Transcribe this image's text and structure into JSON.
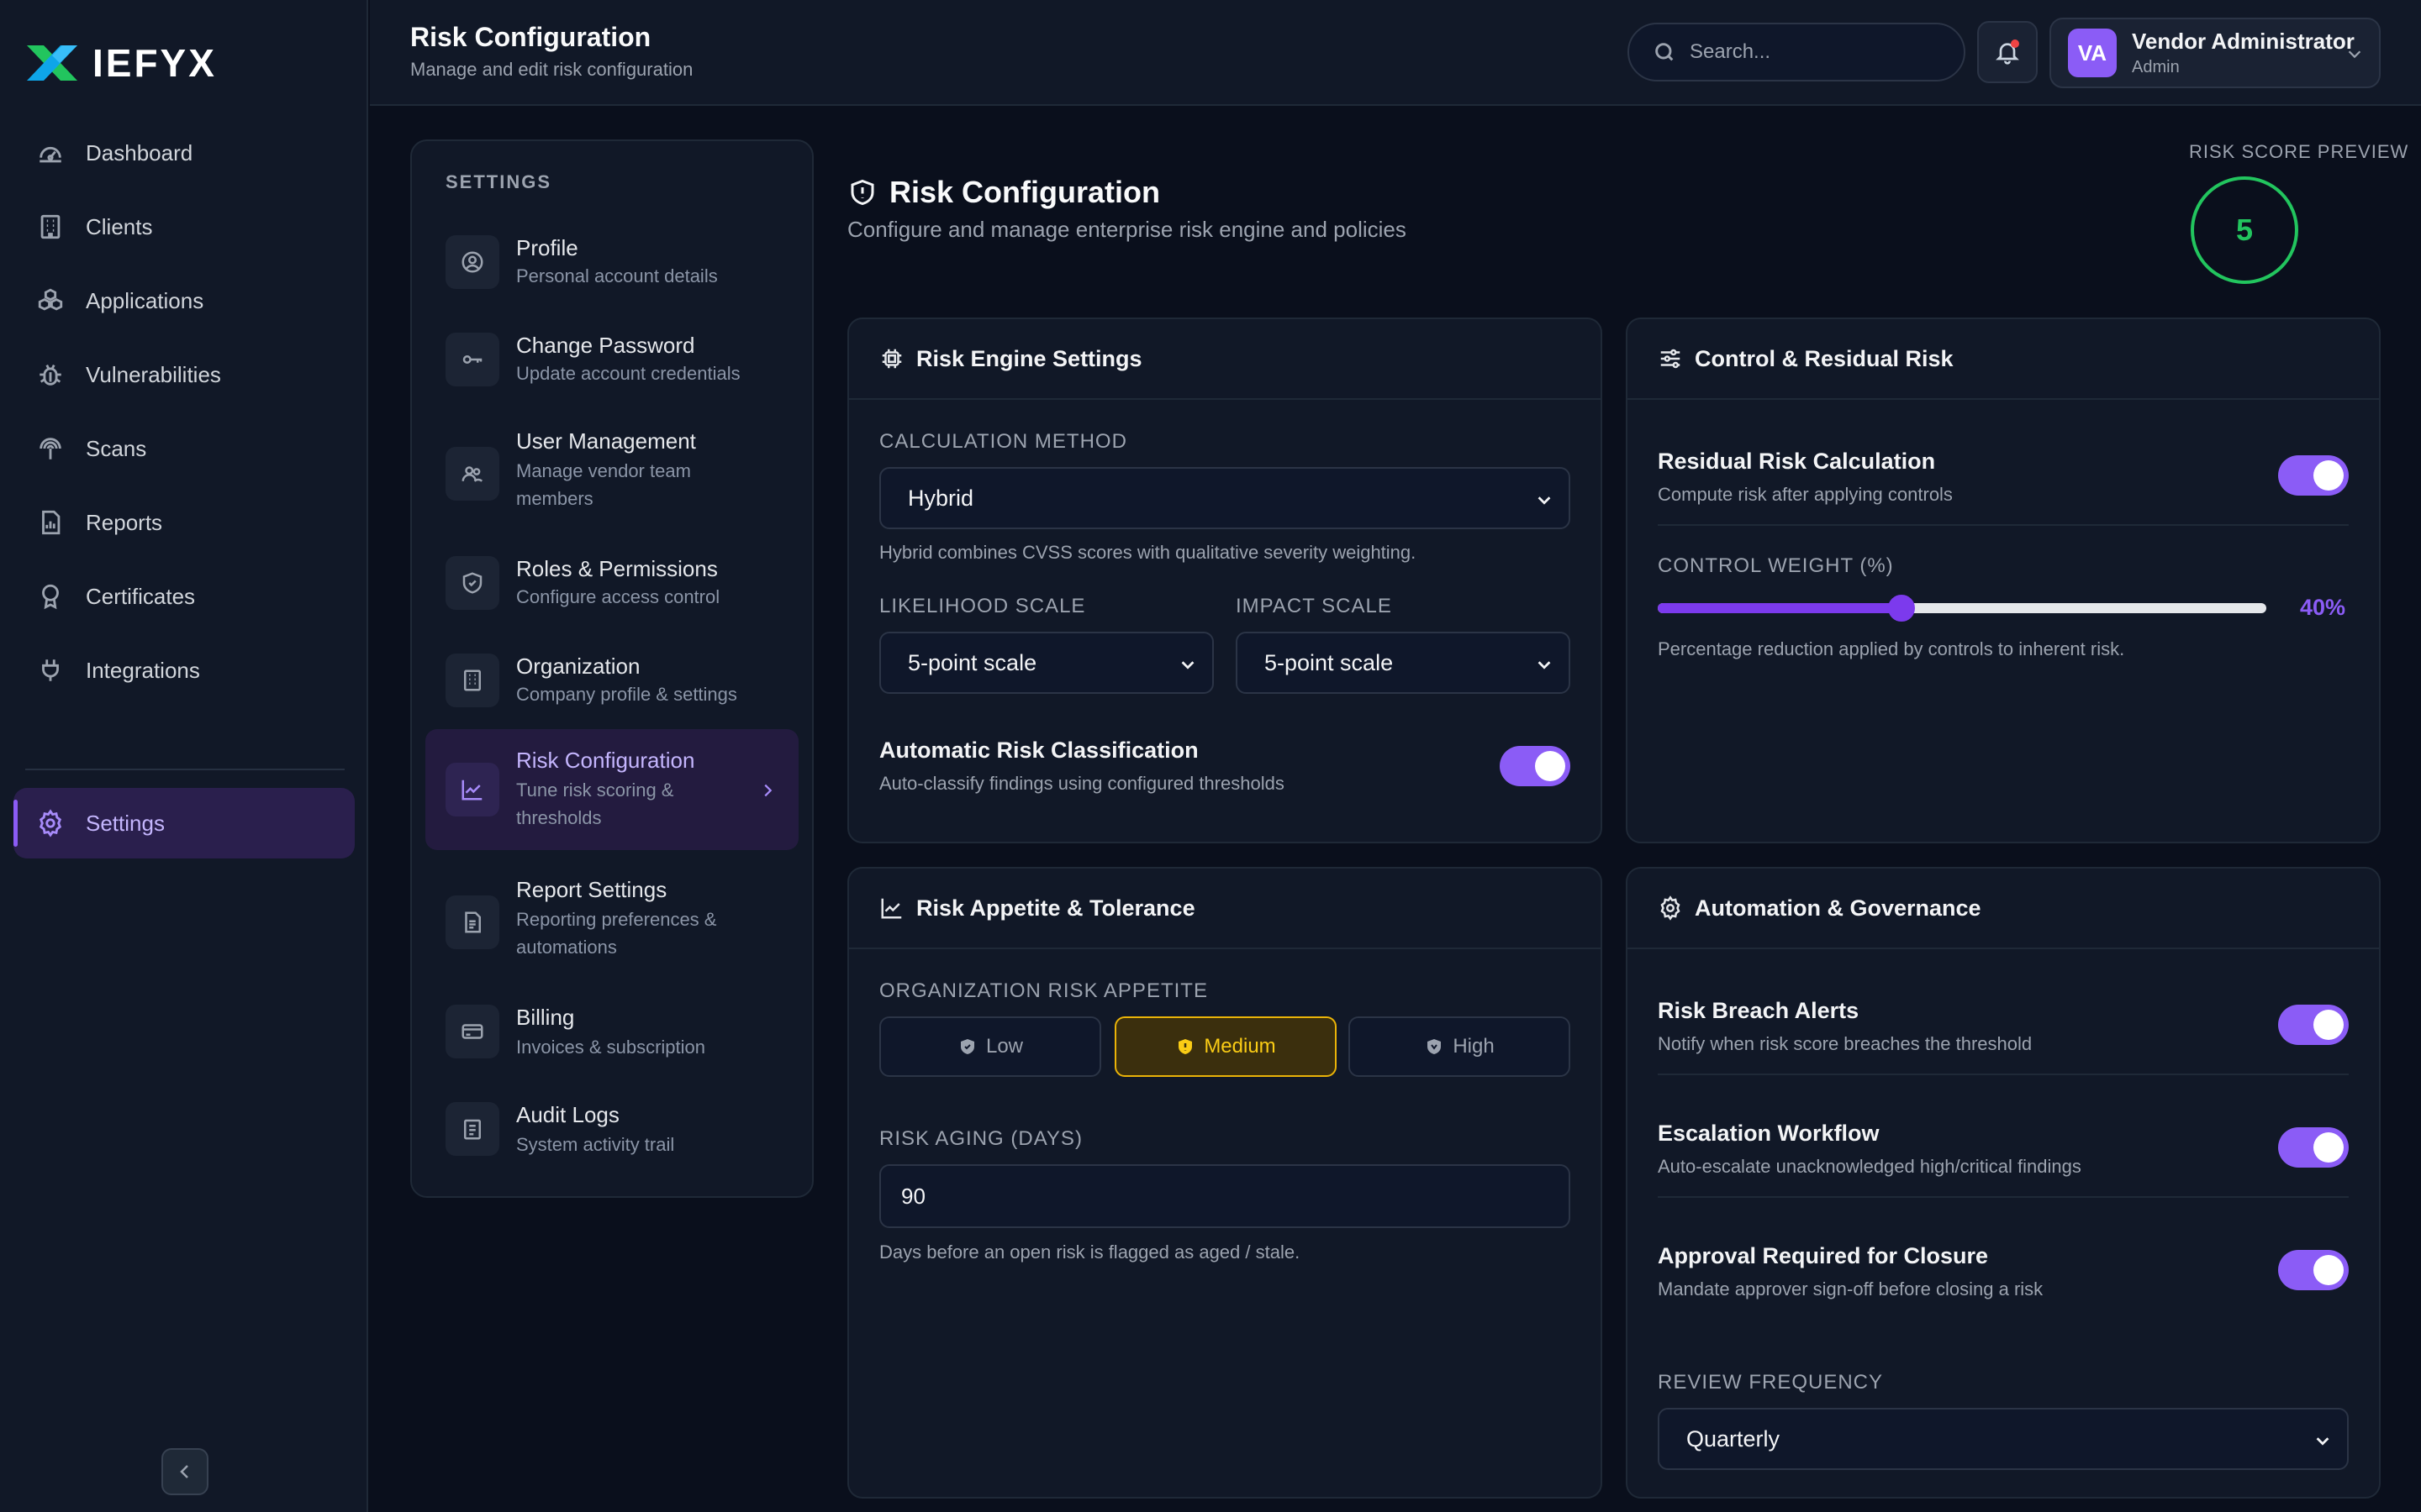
{
  "brand": {
    "name": "IEFYX"
  },
  "sidebar": {
    "items": [
      {
        "label": "Dashboard",
        "icon": "gauge-icon"
      },
      {
        "label": "Clients",
        "icon": "building-icon"
      },
      {
        "label": "Applications",
        "icon": "cubes-icon"
      },
      {
        "label": "Vulnerabilities",
        "icon": "bug-icon"
      },
      {
        "label": "Scans",
        "icon": "radar-icon"
      },
      {
        "label": "Reports",
        "icon": "report-icon"
      },
      {
        "label": "Certificates",
        "icon": "award-icon"
      },
      {
        "label": "Integrations",
        "icon": "plug-icon"
      }
    ],
    "active": {
      "label": "Settings",
      "icon": "gear-icon"
    }
  },
  "header": {
    "title": "Risk Configuration",
    "subtitle": "Manage and edit risk configuration",
    "search_placeholder": "Search...",
    "user": {
      "initials": "VA",
      "name": "Vendor Administrator",
      "role": "Admin"
    }
  },
  "settings_menu": {
    "heading": "SETTINGS",
    "items": [
      {
        "title": "Profile",
        "desc": "Personal account details"
      },
      {
        "title": "Change Password",
        "desc": "Update account credentials"
      },
      {
        "title": "User Management",
        "desc": "Manage vendor team members"
      },
      {
        "title": "Roles & Permissions",
        "desc": "Configure access control"
      },
      {
        "title": "Organization",
        "desc": "Company profile & settings"
      },
      {
        "title": "Risk Configuration",
        "desc": "Tune risk scoring & thresholds"
      },
      {
        "title": "Report Settings",
        "desc": "Reporting preferences & automations"
      },
      {
        "title": "Billing",
        "desc": "Invoices & subscription"
      },
      {
        "title": "Audit Logs",
        "desc": "System activity trail"
      }
    ]
  },
  "main": {
    "title": "Risk Configuration",
    "subtitle": "Configure and manage enterprise risk engine and policies",
    "preview": {
      "label": "RISK SCORE PREVIEW",
      "value": "5",
      "color": "#22c55e"
    }
  },
  "engine": {
    "title": "Risk Engine Settings",
    "calc_label": "CALCULATION METHOD",
    "calc_value": "Hybrid",
    "calc_help": "Hybrid combines CVSS scores with qualitative severity weighting.",
    "likelihood_label": "LIKELIHOOD SCALE",
    "likelihood_value": "5-point scale",
    "impact_label": "IMPACT SCALE",
    "impact_value": "5-point scale",
    "auto_title": "Automatic Risk Classification",
    "auto_desc": "Auto-classify findings using configured thresholds",
    "auto_on": true
  },
  "control": {
    "title": "Control & Residual Risk",
    "residual_title": "Residual Risk Calculation",
    "residual_desc": "Compute risk after applying controls",
    "residual_on": true,
    "weight_label": "CONTROL WEIGHT (%)",
    "weight_value": 40,
    "weight_display": "40%",
    "weight_help": "Percentage reduction applied by controls to inherent risk."
  },
  "appetite": {
    "title": "Risk Appetite & Tolerance",
    "org_label": "ORGANIZATION RISK APPETITE",
    "options": [
      "Low",
      "Medium",
      "High"
    ],
    "selected": "Medium",
    "aging_label": "RISK AGING (DAYS)",
    "aging_value": "90",
    "aging_help": "Days before an open risk is flagged as aged / stale."
  },
  "automation": {
    "title": "Automation & Governance",
    "rows": [
      {
        "title": "Risk Breach Alerts",
        "desc": "Notify when risk score breaches the threshold",
        "on": true
      },
      {
        "title": "Escalation Workflow",
        "desc": "Auto-escalate unacknowledged high/critical findings",
        "on": true
      },
      {
        "title": "Approval Required for Closure",
        "desc": "Mandate approver sign-off before closing a risk",
        "on": true
      }
    ],
    "review_label": "REVIEW FREQUENCY",
    "review_value": "Quarterly"
  },
  "colors": {
    "accent": "#8b5cf6",
    "success": "#22c55e",
    "warning": "#eab308",
    "bg": "#0a0f1c",
    "card": "#111827"
  }
}
